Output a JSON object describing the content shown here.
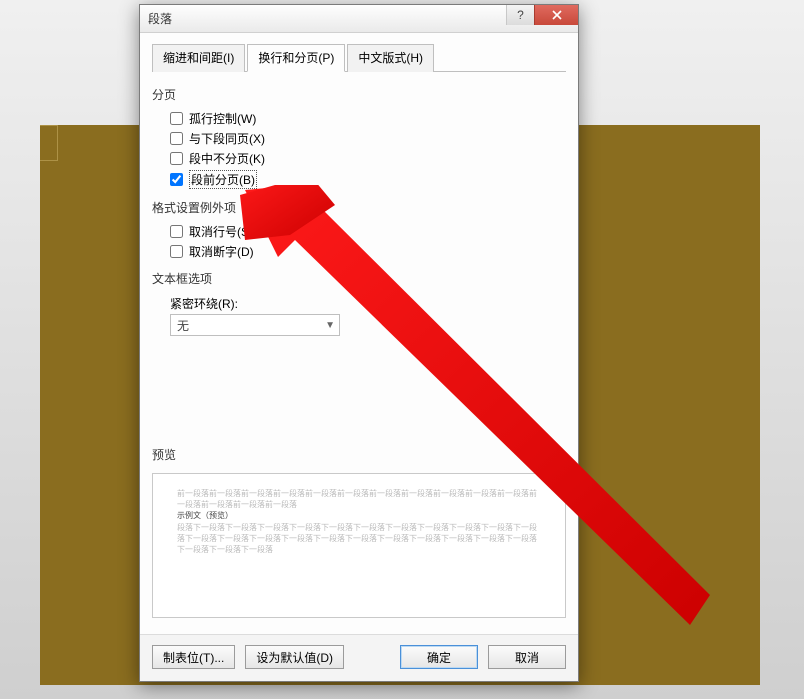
{
  "dialog": {
    "title": "段落",
    "help_label": "?",
    "close_label": "✕"
  },
  "tabs": {
    "t1": "缩进和间距(I)",
    "t2": "换行和分页(P)",
    "t3": "中文版式(H)"
  },
  "sections": {
    "paging": "分页",
    "format_exceptions": "格式设置例外项",
    "textbox_options": "文本框选项",
    "preview": "预览"
  },
  "checks": {
    "widow": "孤行控制(W)",
    "keep_with_next": "与下段同页(X)",
    "keep_together": "段中不分页(K)",
    "page_break_before": "段前分页(B)",
    "suppress_line_numbers": "取消行号(S)",
    "no_hyphen": "取消断字(D)"
  },
  "wrap": {
    "label": "紧密环绕(R):",
    "value": "无"
  },
  "preview": {
    "gray1": "前一段落前一段落前一段落前一段落前一段落前一段落前一段落前一段落前一段落前一段落前一段落前一段落前一段落前一段落前一段落",
    "sample": "示例文（预览）",
    "gray2": "段落下一段落下一段落下一段落下一段落下一段落下一段落下一段落下一段落下一段落下一段落下一段落下一段落下一段落下一段落下一段落下一段落下一段落下一段落下一段落下一段落下一段落下一段落下一段落下一段落下一段落"
  },
  "buttons": {
    "tabs": "制表位(T)...",
    "default": "设为默认值(D)",
    "ok": "确定",
    "cancel": "取消"
  }
}
